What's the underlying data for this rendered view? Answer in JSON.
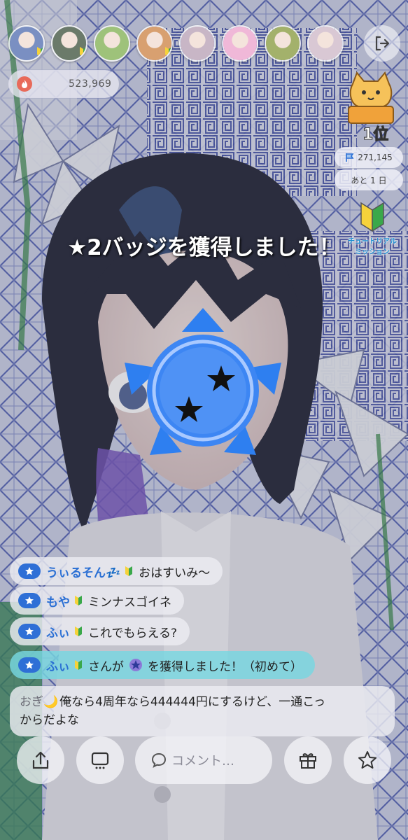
{
  "header": {
    "avatars": [
      {
        "name": "avatar-1",
        "color": "#7a8fc2",
        "beginner": true
      },
      {
        "name": "avatar-2",
        "color": "#6b7a6a",
        "beginner": true
      },
      {
        "name": "avatar-3",
        "color": "#9ec27a",
        "beginner": false
      },
      {
        "name": "avatar-4",
        "color": "#d8a070",
        "beginner": true
      },
      {
        "name": "avatar-5",
        "color": "#c8b6c6",
        "beginner": false
      },
      {
        "name": "avatar-6",
        "color": "#f0b8d8",
        "beginner": false
      },
      {
        "name": "avatar-7",
        "color": "#a3b16b",
        "beginner": false
      },
      {
        "name": "avatar-8",
        "color": "#d9c8d4",
        "beginner": false
      }
    ],
    "points_value": "523,969",
    "exit_icon": "exit-icon"
  },
  "ranking": {
    "rank_label": "1位",
    "score": "271,145",
    "days_left": "あと 1 日",
    "mission_line1": "チュートリアル",
    "mission_line2": "ミッション"
  },
  "announcement": {
    "text": "★2バッジを獲得しました！"
  },
  "comments": [
    {
      "user": "うぃるそん💤",
      "beginner": true,
      "text": "おはすいみ〜"
    },
    {
      "user": "もや",
      "beginner": true,
      "text": "ミンナスゴイネ"
    },
    {
      "user": "ふぃ",
      "beginner": true,
      "text": "これでもらえる?"
    }
  ],
  "system_message": {
    "user": "ふぃ",
    "pre": "さんが",
    "post": "を獲得しました！（初めて）"
  },
  "long_comment": {
    "user": "おぎ🌙",
    "line1": "俺なら4周年なら444444円にするけど、一通こっ",
    "line2": "からだよな"
  },
  "controls": {
    "comment_placeholder": "コメント…",
    "share_icon": "share-icon",
    "screen_icon": "screen-icon",
    "gift_icon": "gift-icon",
    "star_icon": "star-icon"
  },
  "colors": {
    "badge_blue": "#2e7ff0",
    "user_blue": "#2a6fd4",
    "system_teal": "#78d7e1"
  }
}
